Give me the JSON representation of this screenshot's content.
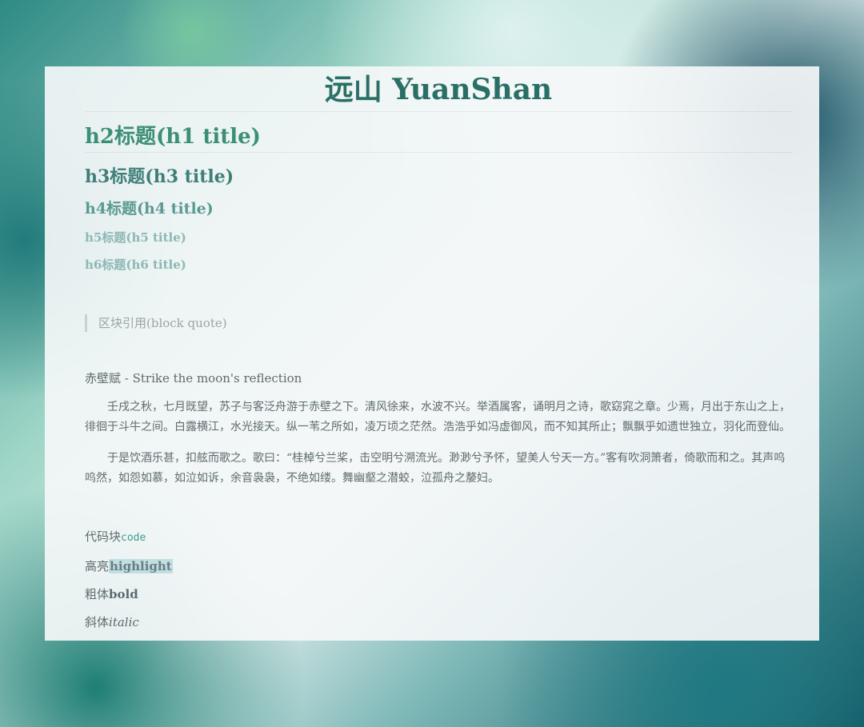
{
  "headings": {
    "h1": "远山 YuanShan",
    "h2": "h2标题(h1 title)",
    "h3": "h3标题(h3 title)",
    "h4": "h4标题(h4 title)",
    "h5": "h5标题(h5 title)",
    "h6": "h6标题(h6 title)"
  },
  "blockquote": "区块引用(block quote)",
  "essay": {
    "title": "赤壁赋 - Strike the moon's reflection",
    "paragraphs": [
      "壬戌之秋，七月既望，苏子与客泛舟游于赤壁之下。清风徐来，水波不兴。举酒属客，诵明月之诗，歌窈窕之章。少焉，月出于东山之上，徘徊于斗牛之间。白露横江，水光接天。纵一苇之所如，凌万顷之茫然。浩浩乎如冯虚御风，而不知其所止；飘飘乎如遗世独立，羽化而登仙。",
      "于是饮酒乐甚，扣舷而歌之。歌曰：“桂棹兮兰桨，击空明兮溯流光。渺渺兮予怀，望美人兮天一方。”客有吹洞箫者，倚歌而和之。其声呜呜然，如怨如慕，如泣如诉，余音袅袅，不绝如缕。舞幽壑之潜蛟，泣孤舟之嫠妇。"
    ]
  },
  "formatting": {
    "code_label": "代码块",
    "code_text": "code",
    "highlight_label": "高亮",
    "highlight_text": "highlight",
    "bold_label": "粗体",
    "bold_text": "bold",
    "italic_label": "斜体",
    "italic_text": "italic"
  },
  "colors": {
    "heading_accent": "#2a6f66",
    "code": "#3c9d93",
    "highlight_bg": "#9bcdd2"
  }
}
